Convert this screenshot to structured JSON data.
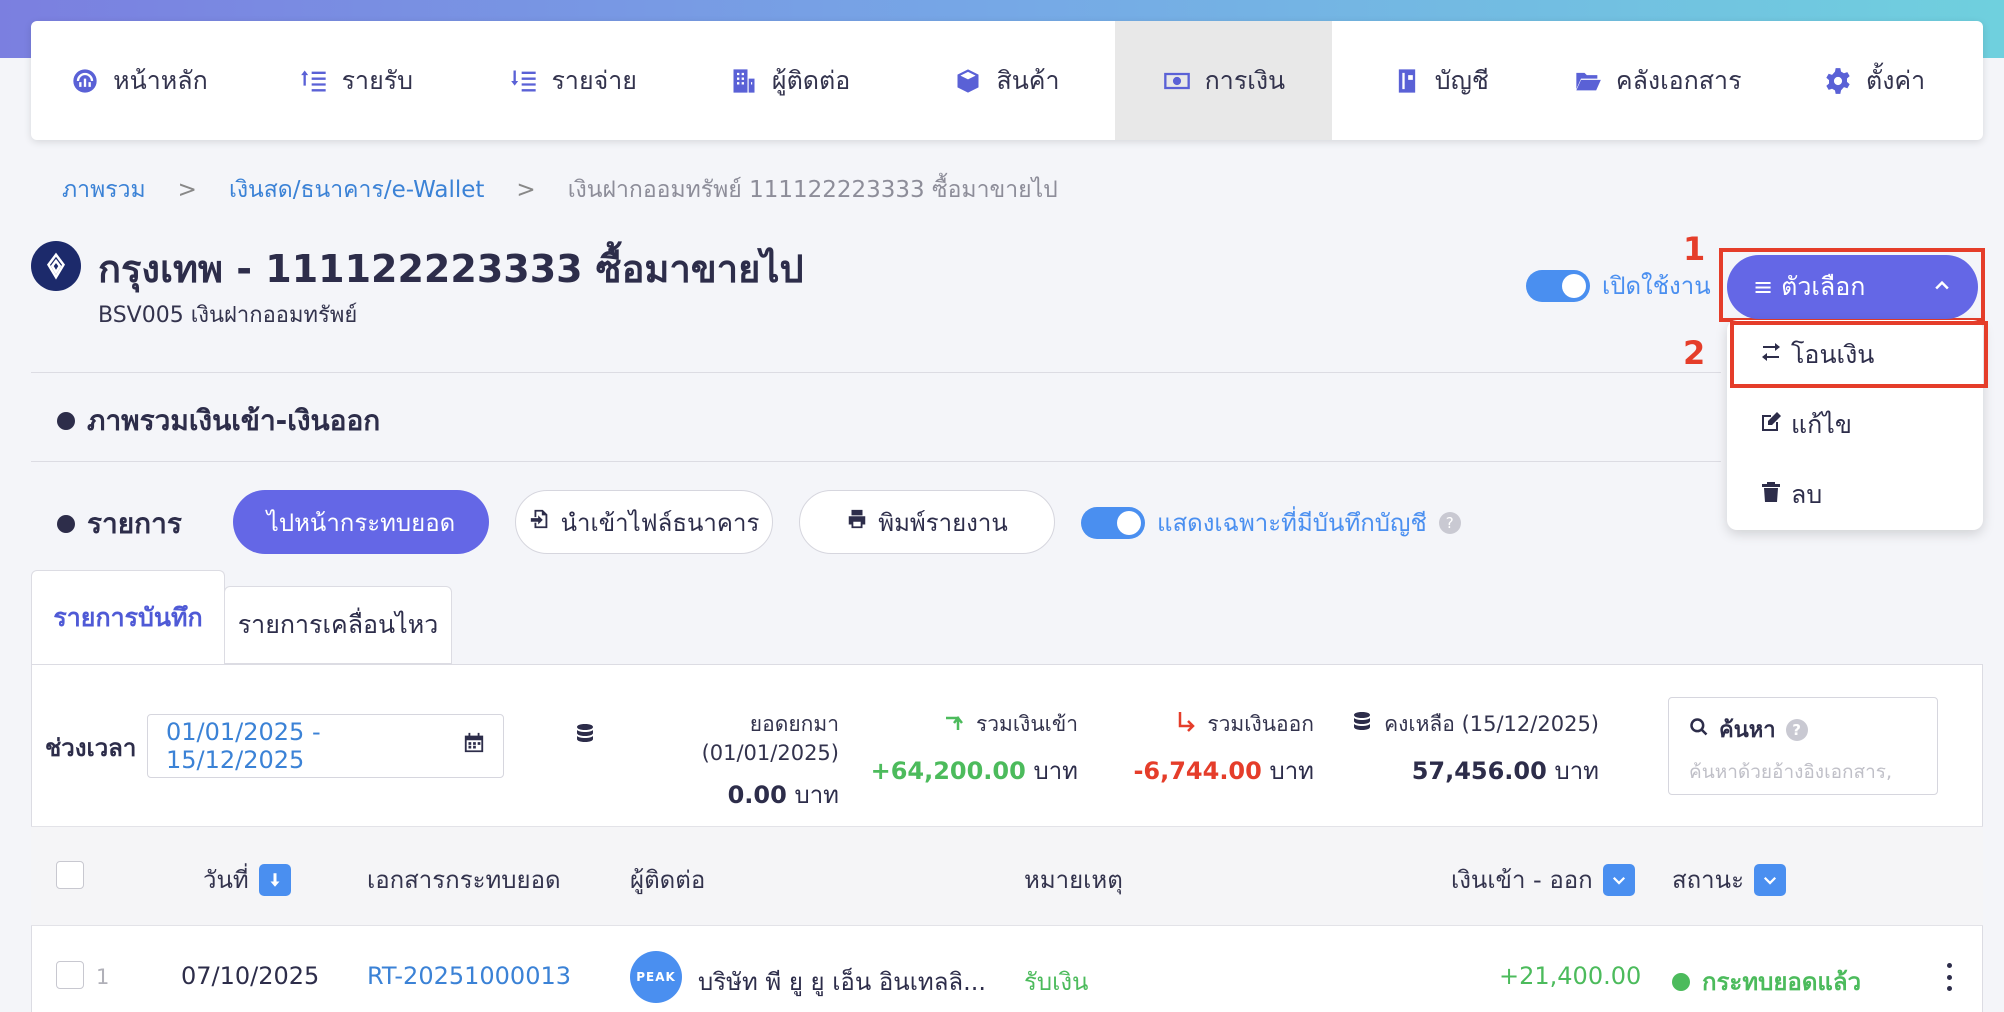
{
  "colors": {
    "accent": "#6467e6",
    "link": "#3b82d6",
    "toggle": "#4a8ff0",
    "positive": "#4cbb5c",
    "negative": "#e53d2a",
    "highlight": "#e53d2a"
  },
  "nav": {
    "items": [
      {
        "label": "หน้าหลัก",
        "icon": "dashboard-gauge-icon"
      },
      {
        "label": "รายรับ",
        "icon": "income-list-icon"
      },
      {
        "label": "รายจ่าย",
        "icon": "expense-list-icon"
      },
      {
        "label": "ผู้ติดต่อ",
        "icon": "building-contacts-icon"
      },
      {
        "label": "สินค้า",
        "icon": "box-icon"
      },
      {
        "label": "การเงิน",
        "icon": "money-bill-icon",
        "active": true
      },
      {
        "label": "บัญชี",
        "icon": "ledger-book-icon"
      },
      {
        "label": "คลังเอกสาร",
        "icon": "folder-open-icon"
      },
      {
        "label": "ตั้งค่า",
        "icon": "gear-icon"
      }
    ]
  },
  "breadcrumb": {
    "level1": "ภาพรวม",
    "level2": "เงินสด/ธนาคาร/e-Wallet",
    "current": "เงินฝากออมทรัพย์ 111122223333 ซื้อมาขายไป",
    "sep": ">"
  },
  "account": {
    "title": "กรุงเทพ - 111122223333 ซื้อมาขายไป",
    "subtitle": "BSV005 เงินฝากออมทรัพย์",
    "enable_label": "เปิดใช้งาน",
    "enabled": true
  },
  "options": {
    "label": "ตัวเลือก",
    "menu": [
      {
        "label": "โอนเงิน",
        "icon": "transfer-arrows-icon"
      },
      {
        "label": "แก้ไข",
        "icon": "edit-icon"
      },
      {
        "label": "ลบ",
        "icon": "trash-icon"
      }
    ]
  },
  "annotations": {
    "step1": "1",
    "step2": "2"
  },
  "sections": {
    "overview": "ภาพรวมเงินเข้า-เงินออก",
    "transactions": "รายการ"
  },
  "actions": {
    "reconcile": "ไปหน้ากระทบยอด",
    "import_bank": "นำเข้าไฟล์ธนาคาร",
    "print_report": "พิมพ์รายงาน",
    "only_recorded": "แสดงเฉพาะที่มีบันทึกบัญชี",
    "help": "?"
  },
  "tabs": {
    "records": "รายการบันทึก",
    "movements": "รายการเคลื่อนไหว"
  },
  "filters": {
    "period_label": "ช่วงเวลา",
    "date_range": "01/01/2025 - 15/12/2025"
  },
  "stats": {
    "opening": {
      "label": "ยอดยกมา (01/01/2025)",
      "value": "0.00",
      "unit": "บาท"
    },
    "income": {
      "label": "รวมเงินเข้า",
      "value": "+64,200.00",
      "unit": "บาท"
    },
    "expense": {
      "label": "รวมเงินออก",
      "value": "-6,744.00",
      "unit": "บาท"
    },
    "balance": {
      "label": "คงเหลือ (15/12/2025)",
      "value": "57,456.00",
      "unit": "บาท"
    }
  },
  "search": {
    "label": "ค้นหา",
    "placeholder": "ค้นหาด้วยอ้างอิงเอกสาร,"
  },
  "table": {
    "headers": {
      "date": "วันที่",
      "doc": "เอกสารกระทบยอด",
      "contact": "ผู้ติดต่อ",
      "note": "หมายเหตุ",
      "amount": "เงินเข้า - ออก",
      "status": "สถานะ"
    },
    "rows": [
      {
        "index": "1",
        "date": "07/10/2025",
        "doc": "RT-20251000013",
        "contact_logo": "PEAK",
        "contact": "บริษัท พี ยู ยู เอ็น อินเทลลิ...",
        "note": "รับเงิน",
        "amount": "+21,400.00",
        "status": "กระทบยอดแล้ว"
      }
    ]
  }
}
